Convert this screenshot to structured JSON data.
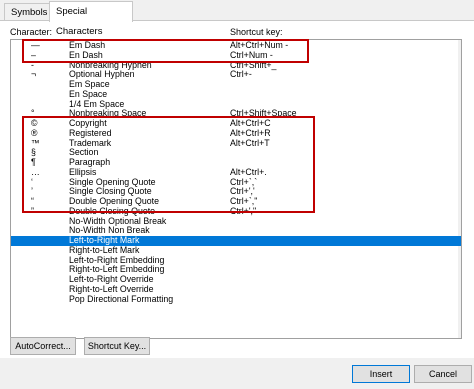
{
  "tabs": [
    {
      "label": "Symbols"
    },
    {
      "label": "Special Characters"
    }
  ],
  "headers": {
    "character": "Character:",
    "shortcut": "Shortcut key:"
  },
  "rows": [
    {
      "char": "—",
      "name": "Em Dash",
      "key": "Alt+Ctrl+Num -"
    },
    {
      "char": "–",
      "name": "En Dash",
      "key": "Ctrl+Num -"
    },
    {
      "char": "‑",
      "name": "Nonbreaking Hyphen",
      "key": "Ctrl+Shift+_"
    },
    {
      "char": "¬",
      "name": "Optional Hyphen",
      "key": "Ctrl+-"
    },
    {
      "char": "",
      "name": "Em Space",
      "key": ""
    },
    {
      "char": "",
      "name": "En Space",
      "key": ""
    },
    {
      "char": "",
      "name": "1/4 Em Space",
      "key": ""
    },
    {
      "char": "°",
      "name": "Nonbreaking Space",
      "key": "Ctrl+Shift+Space"
    },
    {
      "char": "©",
      "name": "Copyright",
      "key": "Alt+Ctrl+C"
    },
    {
      "char": "®",
      "name": "Registered",
      "key": "Alt+Ctrl+R"
    },
    {
      "char": "™",
      "name": "Trademark",
      "key": "Alt+Ctrl+T"
    },
    {
      "char": "§",
      "name": "Section",
      "key": ""
    },
    {
      "char": "¶",
      "name": "Paragraph",
      "key": ""
    },
    {
      "char": "…",
      "name": "Ellipsis",
      "key": "Alt+Ctrl+."
    },
    {
      "char": "‘",
      "name": "Single Opening Quote",
      "key": "Ctrl+`,`"
    },
    {
      "char": "’",
      "name": "Single Closing Quote",
      "key": "Ctrl+','"
    },
    {
      "char": "“",
      "name": "Double Opening Quote",
      "key": "Ctrl+`,\""
    },
    {
      "char": "”",
      "name": "Double Closing Quote",
      "key": "Ctrl+',\""
    },
    {
      "char": "",
      "name": "No-Width Optional Break",
      "key": ""
    },
    {
      "char": "",
      "name": "No-Width Non Break",
      "key": ""
    },
    {
      "char": "",
      "name": "Left-to-Right Mark",
      "key": ""
    },
    {
      "char": "",
      "name": "Right-to-Left Mark",
      "key": ""
    },
    {
      "char": "",
      "name": "Left-to-Right Embedding",
      "key": ""
    },
    {
      "char": "",
      "name": "Right-to-Left Embedding",
      "key": ""
    },
    {
      "char": "",
      "name": "Left-to-Right Override",
      "key": ""
    },
    {
      "char": "",
      "name": "Right-to-Left Override",
      "key": ""
    },
    {
      "char": "",
      "name": "Pop Directional Formatting",
      "key": ""
    }
  ],
  "selected_row": "Left-to-Right Mark",
  "buttons": {
    "autocorrect": "AutoCorrect...",
    "shortcut": "Shortcut Key...",
    "insert": "Insert",
    "cancel": "Cancel"
  },
  "colors": {
    "selection": "#0078d7",
    "highlight_box": "#c00000"
  }
}
